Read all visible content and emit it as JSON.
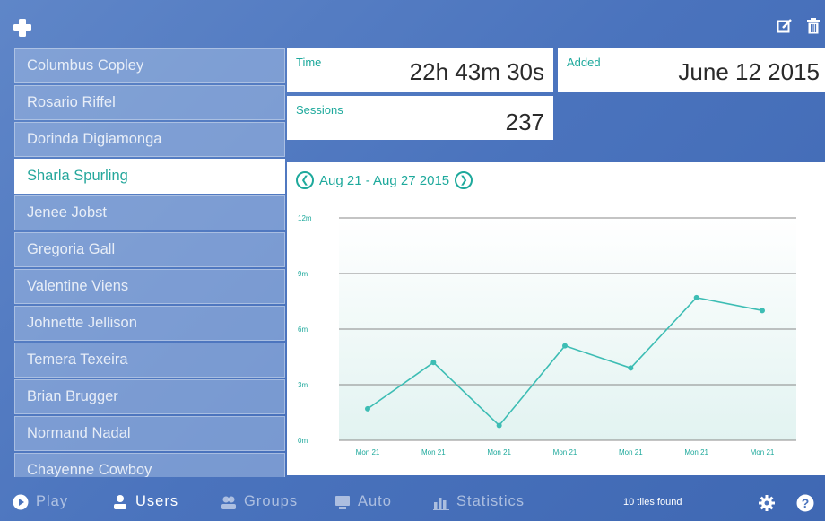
{
  "toolbar": {
    "add_icon": "plus-icon",
    "edit_icon": "edit-icon",
    "delete_icon": "trash-icon"
  },
  "sidebar": {
    "items": [
      {
        "label": "Columbus Copley",
        "selected": false
      },
      {
        "label": "Rosario Riffel",
        "selected": false
      },
      {
        "label": "Dorinda Digiamonga",
        "selected": false
      },
      {
        "label": "Sharla Spurling",
        "selected": true
      },
      {
        "label": "Jenee Jobst",
        "selected": false
      },
      {
        "label": "Gregoria Gall",
        "selected": false
      },
      {
        "label": "Valentine Viens",
        "selected": false
      },
      {
        "label": "Johnette Jellison",
        "selected": false
      },
      {
        "label": "Temera Texeira",
        "selected": false
      },
      {
        "label": "Brian Brugger",
        "selected": false
      },
      {
        "label": "Normand Nadal",
        "selected": false
      },
      {
        "label": "Chayenne Cowboy",
        "selected": false
      }
    ]
  },
  "stats": {
    "time_label": "Time",
    "time_value": "22h 43m 30s",
    "added_label": "Added",
    "added_value": "June 12 2015",
    "sessions_label": "Sessions",
    "sessions_value": "237"
  },
  "chart": {
    "range": "Aug 21 - Aug 27 2015",
    "prev_icon": "chevron-left-icon",
    "next_icon": "chevron-right-icon"
  },
  "chart_data": {
    "type": "line",
    "x": [
      "Mon 21",
      "Mon 21",
      "Mon 21",
      "Mon 21",
      "Mon 21",
      "Mon 21",
      "Mon 21"
    ],
    "y_ticks": [
      "0m",
      "3m",
      "6m",
      "9m",
      "12m"
    ],
    "ylim": [
      0,
      12
    ],
    "series": [
      {
        "values": [
          1.7,
          4.2,
          0.8,
          5.1,
          3.9,
          7.7,
          7.0
        ]
      }
    ],
    "grid": true,
    "line_color": "#3dbdb4"
  },
  "bottombar": {
    "tabs": [
      {
        "label": "Play",
        "icon": "play-icon",
        "active": false
      },
      {
        "label": "Users",
        "icon": "user-icon",
        "active": true
      },
      {
        "label": "Groups",
        "icon": "group-icon",
        "active": false
      },
      {
        "label": "Auto",
        "icon": "auto-icon",
        "active": false
      },
      {
        "label": "Statistics",
        "icon": "bar-chart-icon",
        "active": false
      }
    ],
    "status": "10 tiles found",
    "settings_icon": "gear-icon",
    "help_icon": "help-icon"
  },
  "colors": {
    "accent": "#1ea99c",
    "background": "#4a73bd"
  }
}
